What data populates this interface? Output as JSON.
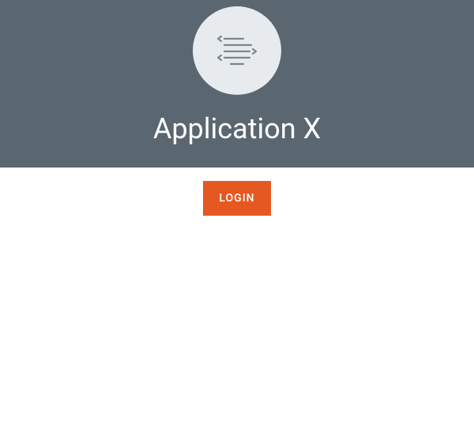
{
  "header": {
    "title": "Application X",
    "logo_icon": "code-lines-icon"
  },
  "actions": {
    "login_label": "LOGIN"
  }
}
